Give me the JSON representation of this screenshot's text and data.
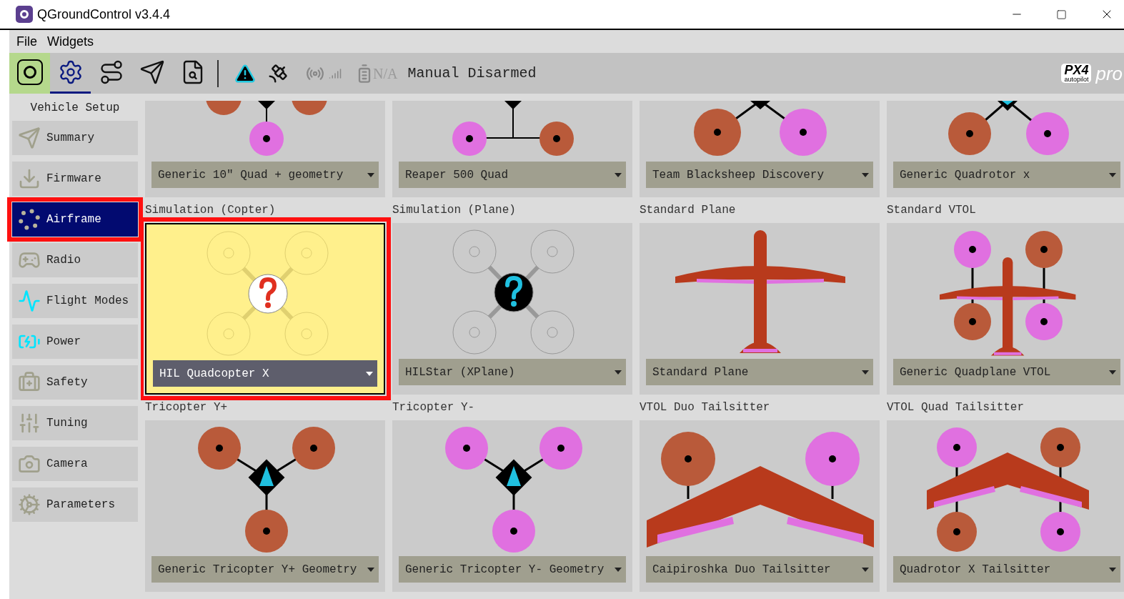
{
  "window": {
    "title": "QGroundControl v3.4.4"
  },
  "menu": [
    "File",
    "Widgets"
  ],
  "toolbar": {
    "views": [
      {
        "selected": false
      },
      {
        "selected": true
      },
      {
        "selected": false
      },
      {
        "selected": false
      },
      {
        "selected": false
      }
    ],
    "battery": "N/A",
    "flight_mode": "Manual",
    "arm_state": "Disarmed",
    "logo": {
      "mark": "PX4",
      "tagline": "autopilot",
      "suffix": "pro"
    }
  },
  "sidebar": {
    "title": "Vehicle Setup",
    "items": [
      {
        "label": "Summary",
        "selected": false
      },
      {
        "label": "Firmware",
        "selected": false
      },
      {
        "label": "Airframe",
        "selected": true
      },
      {
        "label": "Radio",
        "selected": false
      },
      {
        "label": "Flight Modes",
        "selected": false
      },
      {
        "label": "Power",
        "selected": false
      },
      {
        "label": "Safety",
        "selected": false
      },
      {
        "label": "Tuning",
        "selected": false
      },
      {
        "label": "Camera",
        "selected": false
      },
      {
        "label": "Parameters",
        "selected": false
      }
    ]
  },
  "scrolled_cards": [
    {
      "kind": "quad_plus",
      "model": "Generic 10″ Quad + geometry"
    },
    {
      "kind": "reaper",
      "model": "Reaper 500 Quad"
    },
    {
      "kind": "blacksheep",
      "model": "Team Blacksheep Discovery"
    },
    {
      "kind": "quad_x",
      "model": "Generic Quadrotor x"
    }
  ],
  "groups": [
    {
      "title": "Simulation (Copter)",
      "kind": "sim_copter",
      "model": "HIL Quadcopter X",
      "selected": true
    },
    {
      "title": "Simulation (Plane)",
      "kind": "sim_plane",
      "model": "HILStar (XPlane)",
      "selected": false
    },
    {
      "title": "Standard Plane",
      "kind": "plane",
      "model": "Standard Plane",
      "selected": false
    },
    {
      "title": "Standard VTOL",
      "kind": "quadplane",
      "model": "Generic Quadplane VTOL",
      "selected": false
    },
    {
      "title": "Tricopter Y+",
      "kind": "tri_plus",
      "model": "Generic Tricopter Y+ Geometry",
      "selected": false
    },
    {
      "title": "Tricopter Y-",
      "kind": "tri_minus",
      "model": "Generic Tricopter Y- Geometry",
      "selected": false
    },
    {
      "title": "VTOL Duo Tailsitter",
      "kind": "duo_tailsitter",
      "model": "Caipiroshka Duo Tailsitter",
      "selected": false
    },
    {
      "title": "VTOL Quad Tailsitter",
      "kind": "quad_tailsitter",
      "model": "Quadrotor X Tailsitter",
      "selected": false
    }
  ]
}
